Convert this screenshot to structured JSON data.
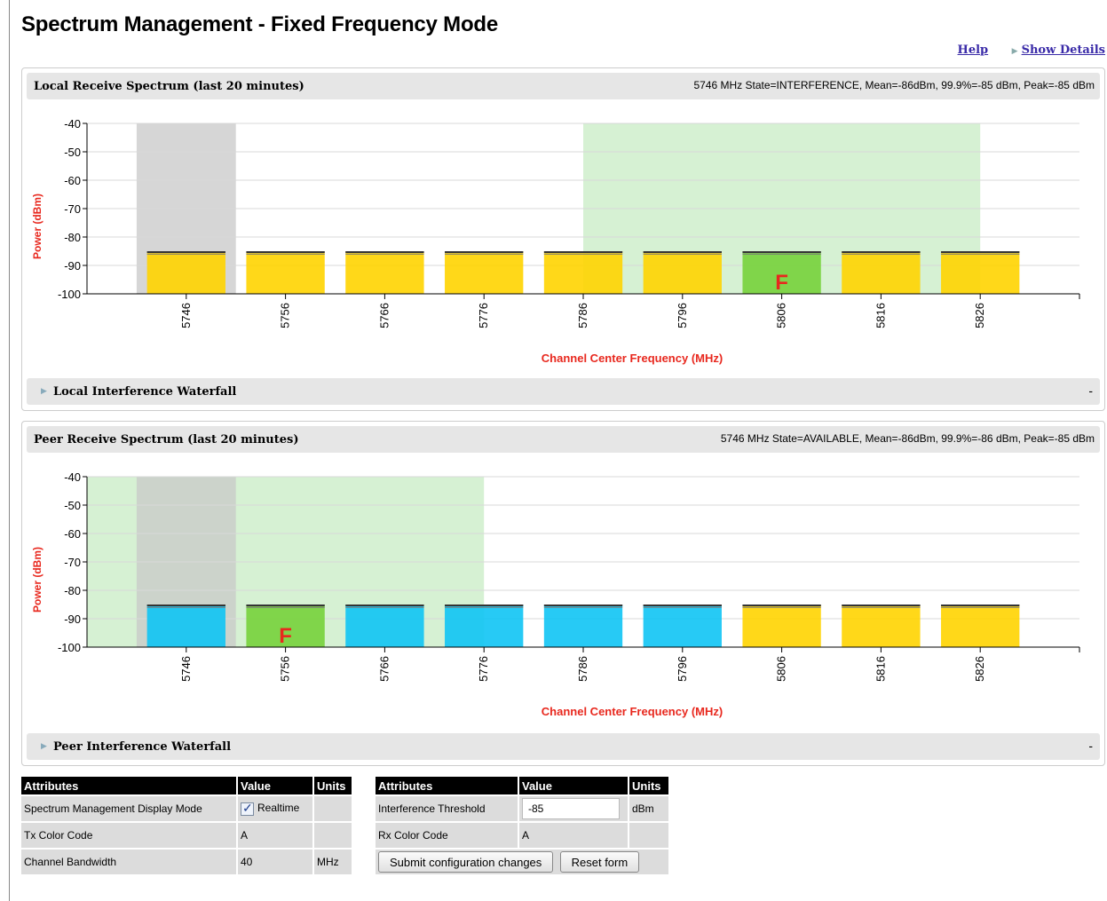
{
  "page": {
    "title": "Spectrum Management - Fixed Frequency Mode",
    "help_label": "Help",
    "show_details_label": "Show Details"
  },
  "local": {
    "title": "Local Receive Spectrum (last 20 minutes)",
    "stats": "5746 MHz State=INTERFERENCE, Mean=-86dBm, 99.9%=-85 dBm, Peak=-85 dBm",
    "waterfall_label": "Local Interference Waterfall",
    "waterfall_toggle": "-"
  },
  "peer": {
    "title": "Peer Receive Spectrum (last 20 minutes)",
    "stats": "5746 MHz State=AVAILABLE, Mean=-86dBm, 99.9%=-86 dBm, Peak=-85 dBm",
    "waterfall_label": "Peer Interference Waterfall",
    "waterfall_toggle": "-"
  },
  "chart_data": [
    {
      "type": "bar",
      "name": "local",
      "xlabel": "Channel Center Frequency (MHz)",
      "ylabel": "Power (dBm)",
      "ylim": [
        -100,
        -40
      ],
      "yticks": [
        -40,
        -50,
        -60,
        -70,
        -80,
        -90,
        -100
      ],
      "categories": [
        "5746",
        "5756",
        "5766",
        "5776",
        "5786",
        "5796",
        "5806",
        "5816",
        "5826"
      ],
      "values": [
        -85,
        -85,
        -85,
        -85,
        -85,
        -85,
        -85,
        -85,
        -85
      ],
      "mean_values": [
        -86,
        -86,
        -86,
        -86,
        -86,
        -86,
        -86,
        -86,
        -86
      ],
      "colors": [
        "#ffd400",
        "#ffd400",
        "#ffd400",
        "#ffd400",
        "#ffd400",
        "#ffd400",
        "#77d23b",
        "#ffd400",
        "#ffd400"
      ],
      "marker": {
        "category": "5806",
        "label": "F",
        "color": "#e8281e"
      },
      "shaded_regions": [
        {
          "from": 5741,
          "to": 5751,
          "color": "#c8c8c8"
        },
        {
          "from": 5786,
          "to": 5826,
          "color": "#c8ecc4"
        }
      ],
      "grid": true
    },
    {
      "type": "bar",
      "name": "peer",
      "xlabel": "Channel Center Frequency (MHz)",
      "ylabel": "Power (dBm)",
      "ylim": [
        -100,
        -40
      ],
      "yticks": [
        -40,
        -50,
        -60,
        -70,
        -80,
        -90,
        -100
      ],
      "categories": [
        "5746",
        "5756",
        "5766",
        "5776",
        "5786",
        "5796",
        "5806",
        "5816",
        "5826"
      ],
      "values": [
        -85,
        -85,
        -85,
        -85,
        -85,
        -85,
        -85,
        -85,
        -85
      ],
      "mean_values": [
        -86,
        -86,
        -86,
        -86,
        -86,
        -86,
        -86,
        -86,
        -86
      ],
      "colors": [
        "#10c4f4",
        "#77d23b",
        "#10c4f4",
        "#10c4f4",
        "#10c4f4",
        "#10c4f4",
        "#ffd400",
        "#ffd400",
        "#ffd400"
      ],
      "marker": {
        "category": "5756",
        "label": "F",
        "color": "#e8281e"
      },
      "shaded_regions": [
        {
          "from": 5736,
          "to": 5776,
          "color": "#c8ecc4"
        },
        {
          "from": 5741,
          "to": 5751,
          "color": "#c8c8c8"
        }
      ],
      "grid": true
    }
  ],
  "table1": {
    "headers": [
      "Attributes",
      "Value",
      "Units"
    ],
    "rows": [
      {
        "attr": "Spectrum Management Display Mode",
        "value": "Realtime",
        "units": ""
      },
      {
        "attr": "Tx Color Code",
        "value": "A",
        "units": ""
      },
      {
        "attr": "Channel Bandwidth",
        "value": "40",
        "units": "MHz"
      }
    ]
  },
  "table2": {
    "headers": [
      "Attributes",
      "Value",
      "Units"
    ],
    "rows": [
      {
        "attr": "Interference Threshold",
        "value": "-85",
        "units": "dBm"
      },
      {
        "attr": "Rx Color Code",
        "value": "A",
        "units": ""
      }
    ],
    "submit_label": "Submit configuration changes",
    "reset_label": "Reset form"
  }
}
